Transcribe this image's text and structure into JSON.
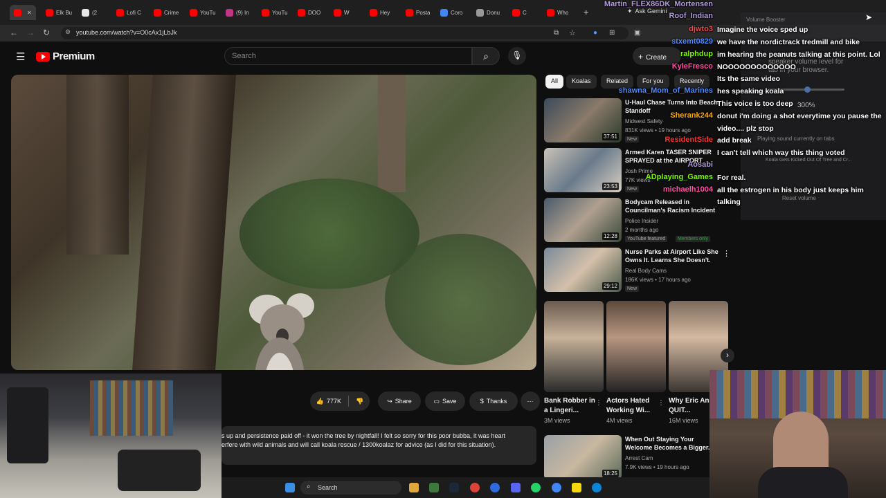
{
  "browser": {
    "tabs": [
      {
        "label": "",
        "color": "#ff0000"
      },
      {
        "label": "Elk Bu",
        "color": "#ff0000"
      },
      {
        "label": "(2",
        "color": "#e8e8e8"
      },
      {
        "label": "Lofi C",
        "color": "#ff0000"
      },
      {
        "label": "Crime",
        "color": "#ff0000"
      },
      {
        "label": "YouTu",
        "color": "#ff0000"
      },
      {
        "label": "(9) In",
        "color": "#c13584"
      },
      {
        "label": "YouTu",
        "color": "#ff0000"
      },
      {
        "label": "DOO",
        "color": "#ff0000"
      },
      {
        "label": "W",
        "color": "#ff0000"
      },
      {
        "label": "Hey",
        "color": "#ff0000"
      },
      {
        "label": "Posta",
        "color": "#ff0000"
      },
      {
        "label": "Coro",
        "color": "#4285f4"
      },
      {
        "label": "Donu",
        "color": "#999999"
      },
      {
        "label": "C",
        "color": "#ff0000"
      },
      {
        "label": "Who",
        "color": "#ff0000"
      }
    ],
    "ask_gemini": "Ask Gemini",
    "url": "youtube.com/watch?v=O0cAx1jLbJk"
  },
  "youtube": {
    "logo": "Premium",
    "search_placeholder": "Search",
    "create": "Create",
    "chips": [
      "All",
      "Koalas",
      "Related",
      "For you",
      "Recently"
    ],
    "actions": {
      "likes": "777K",
      "share": "Share",
      "save": "Save",
      "thanks": "Thanks"
    },
    "description": [
      "s up and persistence paid off - it won the tree by nightfall! I felt so sorry for this poor bubba, it was heart",
      "erfere with wild animals and will call  koala rescue / 1300koalaz  for advice (as I did for this situation)."
    ],
    "recommendations": [
      {
        "title": "U-Haul Chase Turns Into Beach Standoff",
        "channel": "Midwest Safety",
        "meta": "831K views • 19 hours ago",
        "badge": "New",
        "duration": "37:51"
      },
      {
        "title": "Armed Karen TASER SNIPER SPRAYED at the AIRPORT",
        "channel": "Josh Prime",
        "meta": "77K views",
        "badge": "New",
        "duration": "23:53"
      },
      {
        "title": "Bodycam Released in Councilman's Racism Incident",
        "channel": "Police Insider",
        "meta": "2 months ago",
        "badge": "YouTube featured",
        "extra": "Members only",
        "duration": "12:28"
      },
      {
        "title": "Nurse Parks at Airport Like She Owns It. Learns She Doesn't.",
        "channel": "Real Body Cams",
        "meta": "186K views • 17 hours ago",
        "badge": "New",
        "duration": "29:12"
      },
      {
        "title": "When Out Staying Your Welcome Becomes a Bigger...",
        "channel": "Arrest Cam",
        "meta": "7.9K views • 19 hours ago",
        "badge": "",
        "duration": "18:25"
      }
    ],
    "shorts": [
      {
        "title": "Bank Robber in a Lingeri...",
        "views": "3M views"
      },
      {
        "title": "Actors Hated Working Wi...",
        "views": "4M views"
      },
      {
        "title": "Why Eric Andre QUIT...",
        "views": "16M views"
      }
    ]
  },
  "chat": [
    {
      "name": "Martin_FLEX86DK_Mortensen",
      "msg": "",
      "color": "#b19cd9"
    },
    {
      "name": "Roof_Indian",
      "msg": "",
      "color": "#b19cd9"
    },
    {
      "name": "djwto3",
      "msg": "Imagine the voice sped up",
      "color": "#e05050"
    },
    {
      "name": "stxemt0829",
      "msg": "we have the nordictrack tredmill and bike",
      "color": "#4a8cff"
    },
    {
      "name": "ralphdup",
      "msg": "im hearing the peanuts talking at this point. Lol",
      "color": "#7cfc00"
    },
    {
      "name": "KyleFresco",
      "msg": "NOOOOOOOOOOOOO",
      "color": "#ff4fa3"
    },
    {
      "name": "",
      "msg": "Its the same video",
      "color": "#4a4aff"
    },
    {
      "name": "shawna_Mom_of_Marines",
      "msg": "hes speaking koala",
      "color": "#4a8cff"
    },
    {
      "name": "",
      "msg": "This voice is too deep",
      "color": "#7cfc00"
    },
    {
      "name": "Sherank244",
      "msg": "donut i'm doing a shot everytime you pause the",
      "color": "#ffa500"
    },
    {
      "name": "",
      "msg": "video.... plz stop",
      "color": "#ffa500"
    },
    {
      "name": "ResidentSide",
      "msg": "add break",
      "color": "#ff3030"
    },
    {
      "name": "",
      "msg": "I can't tell which way this thing voted",
      "color": "#4a8cff"
    },
    {
      "name": "Aosabi",
      "msg": "",
      "color": "#b19cd9"
    },
    {
      "name": "ADplaying_Games",
      "msg": "For real.",
      "color": "#7cfc00"
    },
    {
      "name": "michaelh1004",
      "msg": "all the estrogen in his body just keeps him",
      "color": "#ff4fa3"
    },
    {
      "name": "",
      "msg": "talking",
      "color": "#ff4fa3"
    }
  ],
  "panel": {
    "title": "Volume Booster",
    "lines": [
      "speaker volume level for",
      "tab in your browser.",
      "Playing sound currently on tabs",
      "Koala Gets Kicked Out Of Tree and Cr...",
      "Reset volume"
    ],
    "percent": "300%"
  },
  "taskbar": {
    "search": "Search"
  }
}
